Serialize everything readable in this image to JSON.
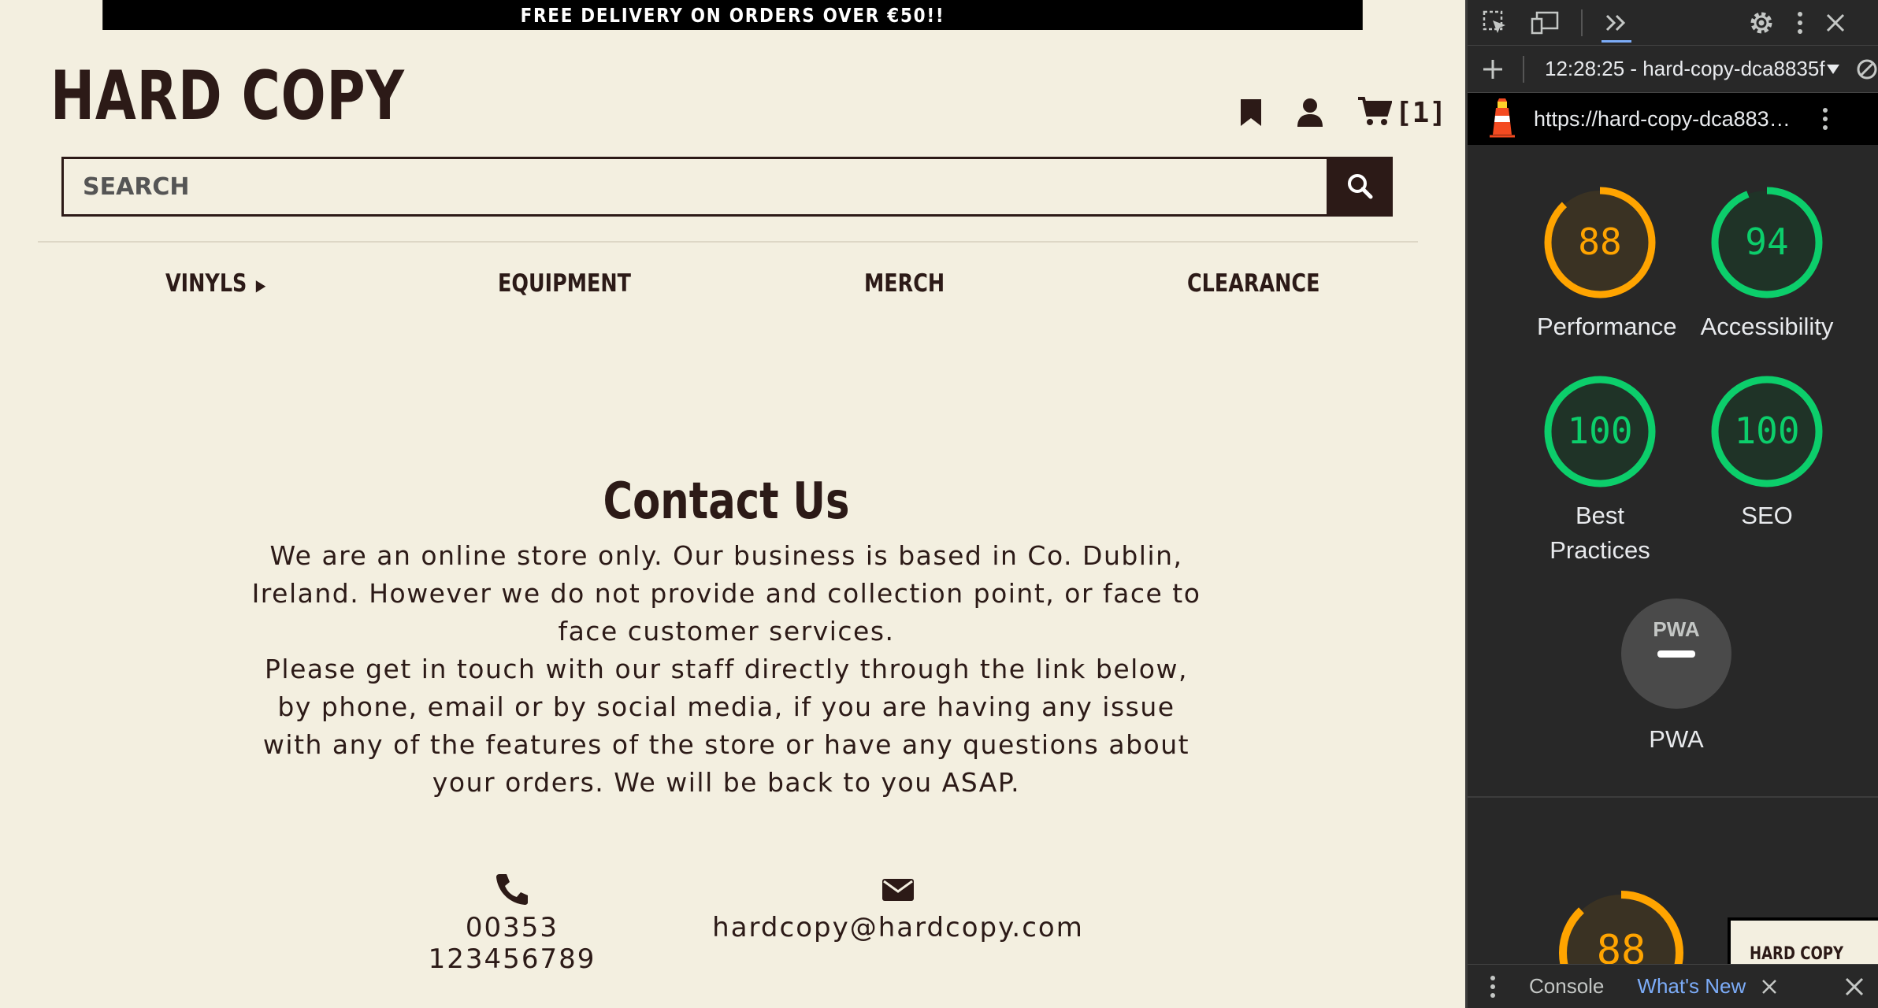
{
  "site": {
    "banner": "FREE DELIVERY ON ORDERS OVER €50!!",
    "logo": "HARD COPY",
    "cart_count": "[1]",
    "search": {
      "placeholder": "SEARCH"
    },
    "nav": [
      {
        "label": "VINYLS",
        "has_submenu": true
      },
      {
        "label": "EQUIPMENT"
      },
      {
        "label": "MERCH"
      },
      {
        "label": "CLEARANCE"
      }
    ],
    "contact": {
      "title": "Contact Us",
      "paragraph_1": "We are an online store only. Our business is based in Co. Dublin, Ireland. However we do not provide and collection point, or face to face customer services.",
      "paragraph_2": "Please get in touch with our staff directly through the link below, by phone, email or by social media, if you are having any issue with any of the features of the store or have any questions about your orders. We will be back to you ASAP.",
      "phone": "00353 123456789",
      "email": "hardcopy@hardcopy.com"
    },
    "colors": {
      "brand": "#2c1a17",
      "background": "#f3efe0",
      "banner": "#000000"
    }
  },
  "devtools": {
    "report_select": "12:28:25 - hard-copy-dca8835f",
    "url": "https://hard-copy-dca8835ff...",
    "scores": [
      {
        "label": "Performance",
        "value": "88",
        "fraction": 0.88,
        "color": "#ffa400"
      },
      {
        "label": "Accessibility",
        "value": "94",
        "fraction": 0.94,
        "color": "#0cce6b"
      },
      {
        "label_line1": "Best",
        "label_line2": "Practices",
        "value": "100",
        "fraction": 1.0,
        "color": "#0cce6b"
      },
      {
        "label": "SEO",
        "value": "100",
        "fraction": 1.0,
        "color": "#0cce6b"
      }
    ],
    "pwa": {
      "label": "PWA",
      "badge": "PWA"
    },
    "summary_score": {
      "value": "88",
      "fraction": 0.88,
      "color": "#ffa400"
    },
    "thumbnail_text": "HARD COPY",
    "drawer": {
      "console": "Console",
      "whats_new": "What's New"
    }
  }
}
